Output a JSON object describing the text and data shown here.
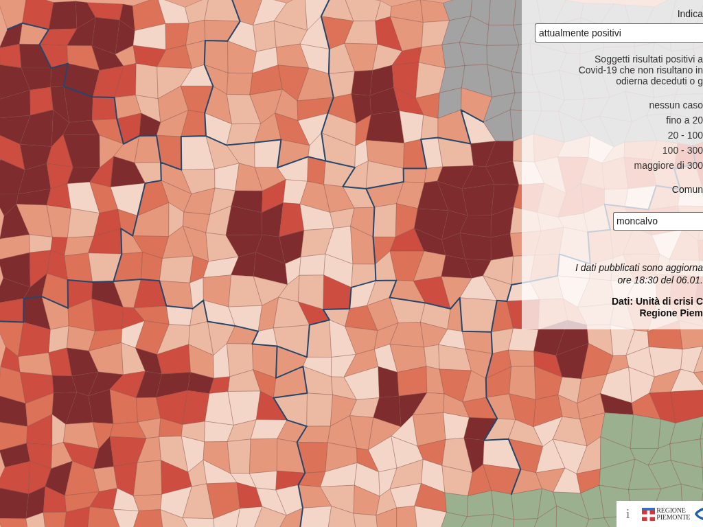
{
  "panel": {
    "indicator_label": "Indica",
    "indicator_select": {
      "value": "attualmente positivi"
    },
    "description": [
      "Soggetti risultati positivi a",
      "Covid-19 che non risultano in",
      "odierna deceduti o g"
    ],
    "legend": [
      "nessun caso",
      "fino a 20",
      "20 - 100",
      "100 - 300",
      "maggiore di 300"
    ],
    "municipality_label": "Comun",
    "municipality_field": {
      "value": "moncalvo"
    },
    "update_note": [
      "I dati pubblicati sono aggiorna",
      "ore 18:30 del 06.01."
    ],
    "source": [
      "Dati: Unità di crisi C",
      "Regione Piem"
    ]
  },
  "footer": {
    "info": "i",
    "logo_text": [
      "REGIONE",
      "PIEMONTE"
    ]
  }
}
